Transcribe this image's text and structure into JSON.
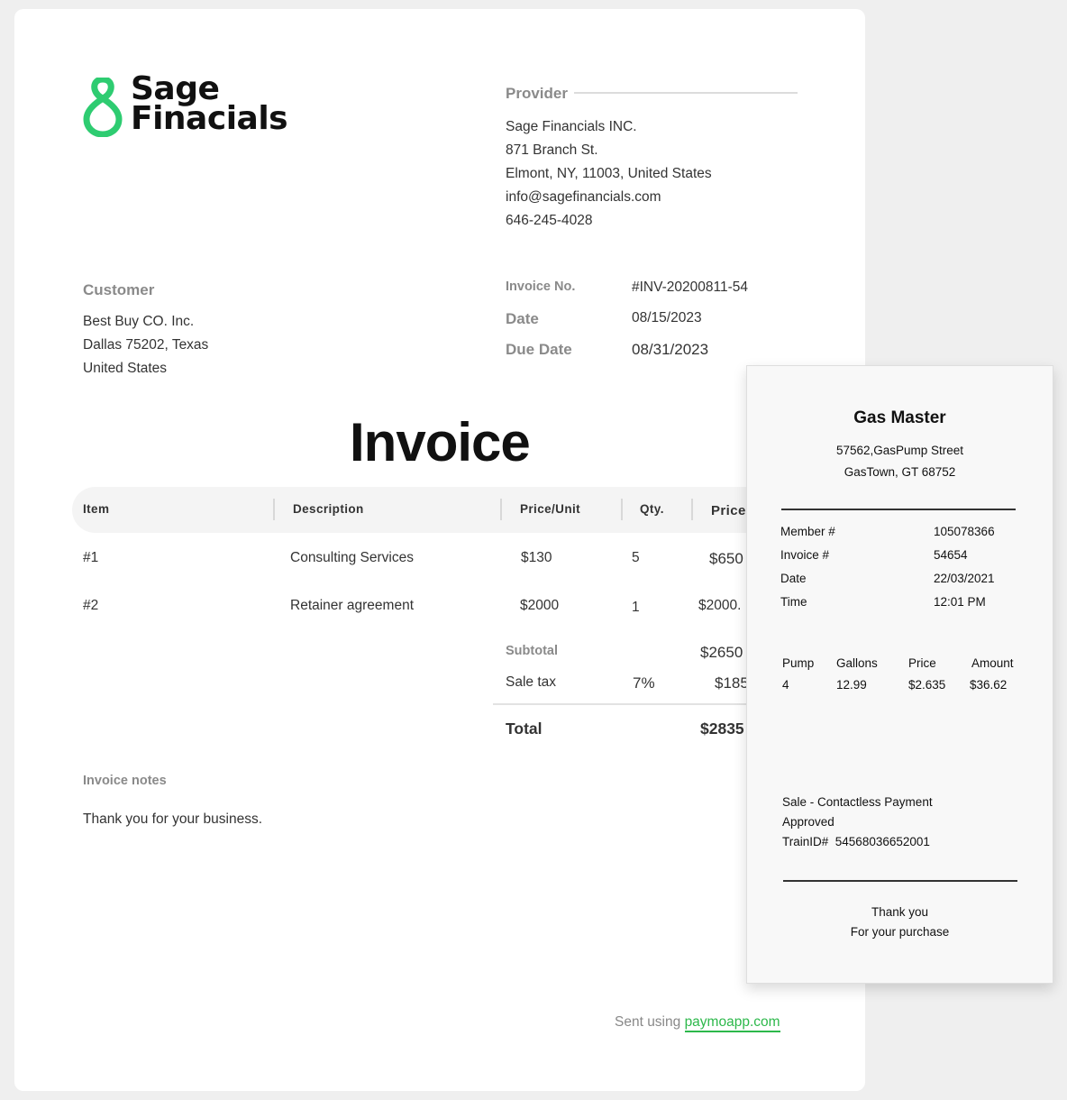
{
  "invoice": {
    "brand": {
      "line1": "Sage",
      "line2": "Finacials",
      "color": "#2ecc71"
    },
    "provider": {
      "label": "Provider",
      "lines": [
        "Sage Financials INC.",
        "871 Branch St.",
        "Elmont, NY, 11003, United States",
        "info@sagefinancials.com",
        "646-245-4028"
      ]
    },
    "customer": {
      "label": "Customer",
      "lines": [
        "Best Buy CO. Inc.",
        "Dallas 75202, Texas",
        "United States"
      ]
    },
    "meta": {
      "invoice_no_label": "Invoice No.",
      "invoice_no": "#INV-20200811-54",
      "date_label": "Date",
      "date": "08/15/2023",
      "due_label": "Due Date",
      "due": "08/31/2023"
    },
    "title": "Invoice",
    "table": {
      "headers": {
        "item": "Item",
        "description": "Description",
        "price_unit": "Price/Unit",
        "qty": "Qty.",
        "price": "Price"
      },
      "rows": [
        {
          "item": "#1",
          "description": "Consulting Services",
          "price_unit": "$130",
          "qty": "5",
          "price": "$650"
        },
        {
          "item": "#2",
          "description": "Retainer agreement",
          "price_unit": "$2000",
          "qty": "1",
          "price": "$2000."
        }
      ]
    },
    "summary": {
      "subtotal_label": "Subtotal",
      "subtotal": "$2650",
      "tax_label": "Sale tax",
      "tax_rate": "7%",
      "tax": "$185",
      "total_label": "Total",
      "total": "$2835"
    },
    "notes": {
      "label": "Invoice notes",
      "text": "Thank you for your business."
    },
    "footer": {
      "sent_prefix": "Sent using",
      "link": "paymoapp.com",
      "link_color": "#2db84b"
    }
  },
  "receipt": {
    "store": "Gas Master",
    "address1": "57562,GasPump Street",
    "address2": "GasTown, GT 68752",
    "fields": [
      {
        "label": "Member #",
        "value": "105078366"
      },
      {
        "label": "Invoice #",
        "value": "54654"
      },
      {
        "label": "Date",
        "value": "22/03/2021"
      },
      {
        "label": "Time",
        "value": "12:01 PM"
      }
    ],
    "columns": {
      "pump": "Pump",
      "gallons": "Gallons",
      "price": "Price",
      "amount": "Amount"
    },
    "values": {
      "pump": "4",
      "gallons": "12.99",
      "price": "$2.635",
      "amount": "$36.62"
    },
    "sale": "Sale - Contactless Payment",
    "status": "Approved",
    "train_label": "TrainID#",
    "train_id": "54568036652001",
    "thanks1": "Thank you",
    "thanks2": "For your purchase"
  }
}
